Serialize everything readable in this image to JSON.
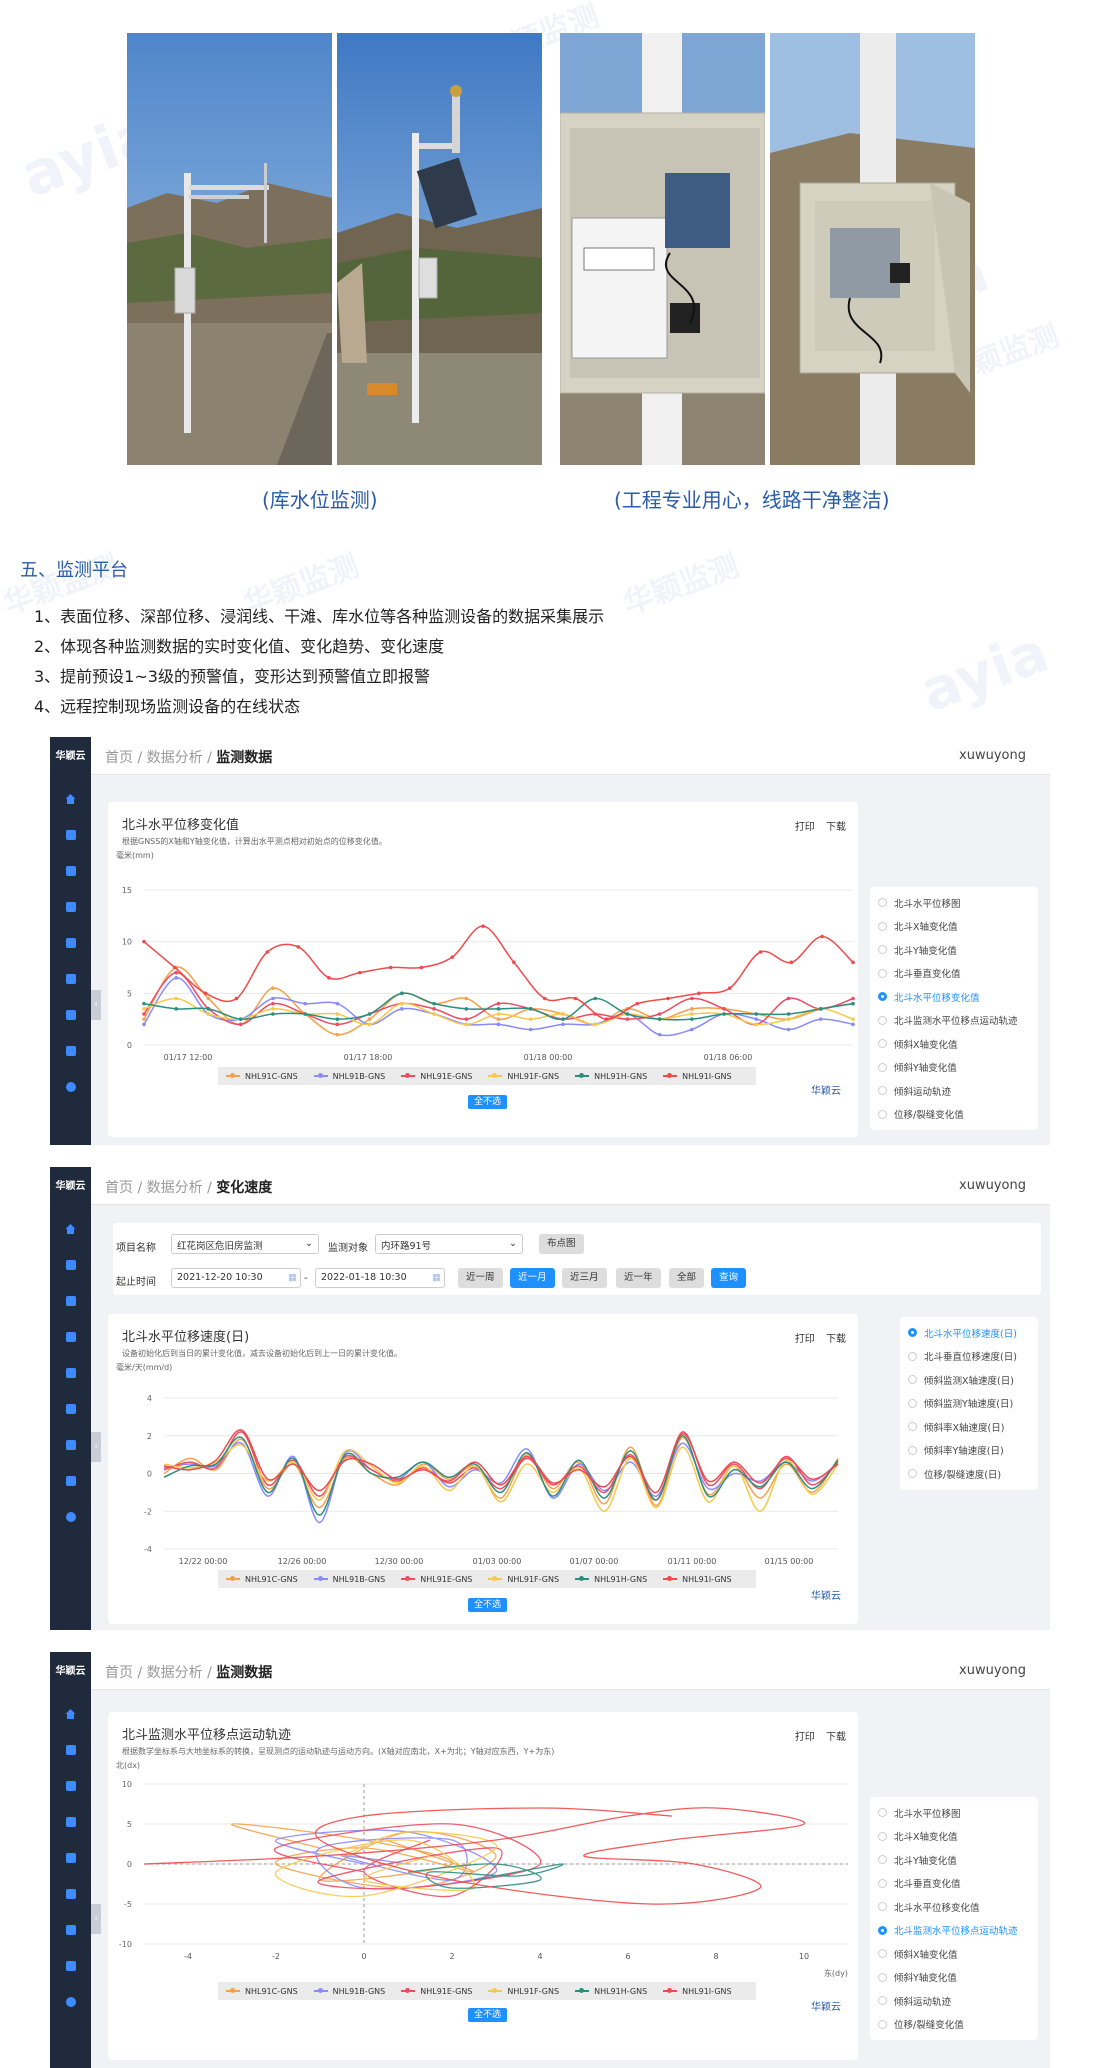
{
  "captions": {
    "left": "(库水位监测)",
    "right": "(工程专业用心，线路干净整洁)"
  },
  "section": {
    "title": "五、监测平台",
    "items": [
      "1、表面位移、深部位移、浸润线、干滩、库水位等各种监测设备的数据采集展示",
      "2、体现各种监测数据的实时变化值、变化趋势、变化速度",
      "3、提前预设1~3级的预警值，变形达到预警值立即报警",
      "4、远程控制现场监测设备的在线状态"
    ]
  },
  "watermark": {
    "latin": "ayia",
    "cn": "华颖监测"
  },
  "sidebar_logo": "华颖云",
  "series_names": [
    "NHL91C-GNS",
    "NHL91B-GNS",
    "NHL91E-GNS",
    "NHL91F-GNS",
    "NHL91H-GNS",
    "NHL91I-GNS"
  ],
  "colors": {
    "s1": "#f5a04a",
    "s2": "#8a8aff",
    "s3": "#ef4b63",
    "s4": "#f7c948",
    "s5": "#2b8f80",
    "s6": "#f04a4a",
    "accent": "#1e90ff"
  },
  "panel1": {
    "breadcrumb": [
      "首页",
      "数据分析",
      "监测数据"
    ],
    "user": "xuwuyong",
    "actions": [
      "打印",
      "下载"
    ],
    "all_button": "全不选",
    "brand": "华颖云",
    "chart_menu": [
      "北斗水平位移图",
      "北斗X轴变化值",
      "北斗Y轴变化值",
      "北斗垂直变化值",
      "北斗水平位移变化值",
      "北斗监测水平位移点运动轨迹",
      "倾斜X轴变化值",
      "倾斜Y轴变化值",
      "倾斜运动轨迹",
      "位移/裂缝变化值"
    ],
    "selected": 4
  },
  "panel2": {
    "breadcrumb": [
      "首页",
      "数据分析",
      "变化速度"
    ],
    "user": "xuwuyong",
    "project_label": "项目名称",
    "project_value": "红花岗区危旧房监测",
    "object_label": "监测对象",
    "object_value": "内环路91号",
    "layout_button": "布点图",
    "time_label": "起止时间",
    "start_time": "2021-12-20 10:30",
    "end_time": "2022-01-18 10:30",
    "time_sep": "-",
    "ranges": [
      "近一周",
      "近一月",
      "近三月",
      "近一年",
      "全部"
    ],
    "active_range": 1,
    "query_button": "查询",
    "actions": [
      "打印",
      "下载"
    ],
    "all_button": "全不选",
    "brand": "华颖云",
    "chart_menu": [
      "北斗水平位移速度(日)",
      "北斗垂直位移速度(日)",
      "倾斜监测X轴速度(日)",
      "倾斜监测Y轴速度(日)",
      "倾斜率X轴速度(日)",
      "倾斜率Y轴速度(日)",
      "位移/裂缝速度(日)"
    ],
    "selected": 0
  },
  "panel3": {
    "breadcrumb": [
      "首页",
      "数据分析",
      "监测数据"
    ],
    "user": "xuwuyong",
    "actions": [
      "打印",
      "下载"
    ],
    "all_button": "全不选",
    "brand": "华颖云",
    "chart_menu": [
      "北斗水平位移图",
      "北斗X轴变化值",
      "北斗Y轴变化值",
      "北斗垂直变化值",
      "北斗水平位移变化值",
      "北斗监测水平位移点运动轨迹",
      "倾斜X轴变化值",
      "倾斜Y轴变化值",
      "倾斜运动轨迹",
      "位移/裂缝变化值"
    ],
    "selected": 5
  },
  "chart_data": [
    {
      "type": "line",
      "title": "北斗水平位移变化值",
      "subtitle": "根据GNSS的X轴和Y轴变化值，计算出水平测点相对初始点的位移变化值。",
      "ylabel": "毫米(mm)",
      "ylim": [
        0,
        15
      ],
      "yticks": [
        0,
        5,
        10,
        15
      ],
      "xticks": [
        "01/17 12:00",
        "01/17 18:00",
        "01/18 00:00",
        "01/18 06:00"
      ],
      "grid": true,
      "legend": "bottom",
      "series": [
        {
          "name": "NHL91C-GNS",
          "values": [
            2.5,
            7.5,
            4.5,
            2,
            5.5,
            3,
            1,
            2.5,
            5,
            4,
            4.5,
            2.5,
            3.5,
            3,
            2,
            3.5,
            2.5,
            3.5,
            3.5,
            3,
            2.5,
            3.5,
            4
          ]
        },
        {
          "name": "NHL91B-GNS",
          "values": [
            2,
            6.5,
            3,
            2.5,
            4.5,
            4,
            4,
            2,
            3.5,
            3,
            2,
            2,
            1.5,
            2,
            2,
            3,
            1,
            1.5,
            3,
            2.5,
            1.5,
            2.5,
            2
          ]
        },
        {
          "name": "NHL91E-GNS",
          "values": [
            3,
            7,
            3.5,
            2,
            4,
            3,
            2,
            3,
            4,
            3.5,
            2.5,
            4,
            3.5,
            2.5,
            3,
            2.5,
            3,
            4.5,
            3.5,
            2,
            4.5,
            3.5,
            4.5
          ]
        },
        {
          "name": "NHL91F-GNS",
          "values": [
            3.5,
            4.5,
            3,
            2.5,
            3.5,
            3,
            3,
            2,
            4,
            3,
            2,
            3,
            2.5,
            3,
            2,
            3,
            2.5,
            3,
            3,
            2,
            2.5,
            3.5,
            2.5
          ]
        },
        {
          "name": "NHL91H-GNS",
          "values": [
            4,
            3.5,
            3.5,
            2.5,
            3,
            3,
            2.5,
            3,
            5,
            4,
            3.5,
            3.5,
            3.5,
            2.5,
            4.5,
            3,
            2.5,
            2.5,
            3,
            3,
            3,
            3.5,
            4
          ]
        },
        {
          "name": "NHL91I-GNS",
          "values": [
            10,
            7.5,
            5,
            4.5,
            9,
            9.5,
            6.5,
            7,
            7.5,
            7.5,
            8.5,
            11.5,
            8,
            4.5,
            4.5,
            2.5,
            4,
            4.5,
            5,
            5.5,
            9,
            8,
            10.5,
            8
          ]
        }
      ]
    },
    {
      "type": "line",
      "title": "北斗水平位移速度(日)",
      "subtitle": "设备初始化后到当日的累计变化值，减去设备初始化后到上一日的累计变化值。",
      "ylabel": "毫米/天(mm/d)",
      "ylim": [
        -4,
        4
      ],
      "yticks": [
        -4,
        -2,
        0,
        2,
        4
      ],
      "xticks": [
        "12/22 00:00",
        "12/26 00:00",
        "12/30 00:00",
        "01/03 00:00",
        "01/07 00:00",
        "01/11 00:00",
        "01/15 00:00"
      ],
      "grid": true,
      "legend": "bottom",
      "series": [
        {
          "name": "NHL91C-GNS",
          "values": [
            0,
            0.8,
            0.2,
            1.8,
            -0.8,
            0.5,
            -1.8,
            0.8,
            0,
            -0.6,
            0.5,
            -0.3,
            0.4,
            -1.3,
            1,
            -0.8,
            0.6,
            -1.6,
            1.4,
            -1.7,
            1.9,
            -1.1,
            0.4,
            -1.3,
            0.5,
            -1,
            0.8
          ]
        },
        {
          "name": "NHL91B-GNS",
          "values": [
            0.3,
            0.5,
            0.4,
            1.6,
            -1.2,
            0.9,
            -2.6,
            1.1,
            0.2,
            -0.3,
            0.6,
            -0.7,
            0.2,
            -0.5,
            1.3,
            -1.3,
            0.5,
            -0.9,
            0.6,
            -1.2,
            1.6,
            -0.8,
            0,
            -0.4,
            0.6,
            -0.4,
            0.6
          ]
        },
        {
          "name": "NHL91E-GNS",
          "values": [
            0.2,
            0.6,
            0.3,
            2.2,
            -0.6,
            0.7,
            -1.2,
            0.9,
            0.2,
            -0.4,
            0.3,
            -0.5,
            0.3,
            -0.8,
            0.8,
            -0.6,
            0.4,
            -1,
            1,
            -1.4,
            2.2,
            -0.6,
            0.5,
            -0.8,
            0.9,
            -0.6,
            0.6
          ]
        },
        {
          "name": "NHL91F-GNS",
          "values": [
            0.5,
            0.3,
            0.6,
            1.5,
            -0.4,
            0.6,
            -1.4,
            1.2,
            0.4,
            -0.5,
            0.4,
            -0.9,
            0.4,
            -1.5,
            0.5,
            -1,
            0.3,
            -2,
            0.8,
            -1.8,
            1.4,
            -1.5,
            0.4,
            -2,
            0.7,
            -1.1,
            0.5
          ]
        },
        {
          "name": "NHL91H-GNS",
          "values": [
            -0.2,
            0.4,
            0.5,
            1.9,
            -1,
            0.8,
            -2.2,
            1,
            0,
            -0.2,
            0.6,
            -0.2,
            0.5,
            -1,
            1.1,
            -1.2,
            0.7,
            -1.3,
            1.2,
            -1.4,
            2,
            -1.2,
            0.2,
            -0.7,
            0.6,
            -0.8,
            0.7
          ]
        },
        {
          "name": "NHL91I-GNS",
          "values": [
            0.4,
            0.2,
            0.7,
            2.3,
            -0.3,
            0.5,
            -0.9,
            0.7,
            0.5,
            -0.3,
            0.2,
            -0.4,
            0.6,
            -0.6,
            0.9,
            -0.5,
            0.2,
            -0.7,
            0.9,
            -1,
            2.1,
            -0.4,
            0.6,
            -0.5,
            0.8,
            -0.3,
            0.5
          ]
        }
      ]
    },
    {
      "type": "line",
      "title": "北斗监测水平位移点运动轨迹",
      "subtitle": "根据数学坐标系与大地坐标系的转换，呈现测点的运动轨迹与运动方向。(X轴对应南北，X+为北；Y轴对应东西，Y+为东)",
      "ylabel": "北(dx)",
      "xlabel": "东(dy)",
      "xlim": [
        -5,
        11
      ],
      "ylim": [
        -10,
        10
      ],
      "xticks": [
        -4,
        -2,
        0,
        2,
        4,
        6,
        8,
        10
      ],
      "yticks": [
        -10,
        -5,
        0,
        5,
        10
      ],
      "grid": true,
      "legend": "bottom",
      "series": [
        {
          "name": "NHL91C-GNS",
          "x": [
            -1,
            -3,
            0,
            2,
            -1,
            1,
            3,
            1,
            -2,
            0,
            2.5,
            0.5
          ],
          "y": [
            2,
            5,
            3,
            0,
            -2,
            4,
            1,
            -3,
            0,
            2,
            -1,
            3
          ]
        },
        {
          "name": "NHL91B-GNS",
          "x": [
            0,
            -2,
            1,
            3,
            0,
            -1,
            2,
            2,
            -0.5,
            1
          ],
          "y": [
            0,
            3,
            4,
            -1,
            -3,
            2,
            3,
            -2,
            1,
            0
          ]
        },
        {
          "name": "NHL91E-GNS",
          "x": [
            0,
            -2,
            2,
            4,
            1,
            -1,
            3,
            2,
            0,
            1.5
          ],
          "y": [
            -1,
            2,
            5,
            0,
            -3,
            -2,
            2,
            -4,
            -1,
            3
          ]
        },
        {
          "name": "NHL91F-GNS",
          "x": [
            -0.5,
            1,
            3,
            0,
            -2,
            1,
            2.5,
            0,
            1.5
          ],
          "y": [
            1,
            4,
            2,
            -4,
            -1,
            3,
            -3,
            -2,
            1
          ]
        },
        {
          "name": "NHL91H-GNS",
          "x": [
            1,
            3,
            4,
            2,
            1.5,
            3.5,
            4.5,
            2.5
          ],
          "y": [
            -1,
            0,
            -2,
            -3,
            -1,
            -1.5,
            0,
            -2
          ]
        },
        {
          "name": "NHL91I-GNS",
          "x": [
            -5,
            -1,
            3,
            6,
            8,
            10,
            7,
            5,
            7.5,
            9,
            6.5,
            2,
            -1,
            0,
            4,
            7
          ],
          "y": [
            0,
            1,
            3,
            6,
            7,
            5,
            3,
            1,
            0,
            -3,
            -5,
            -2,
            3,
            6,
            7,
            6
          ]
        }
      ]
    }
  ]
}
